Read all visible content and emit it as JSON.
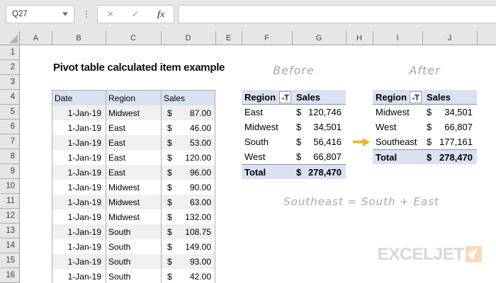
{
  "formula_bar": {
    "name_box_value": "Q27",
    "cancel_glyph": "✕",
    "enter_glyph": "✓",
    "fx_glyph": "fx",
    "formula_value": ""
  },
  "grid": {
    "column_letters": [
      "A",
      "B",
      "C",
      "D",
      "E",
      "F",
      "G",
      "H",
      "I",
      "J"
    ],
    "row_numbers": [
      "1",
      "2",
      "3",
      "4",
      "5",
      "6",
      "7",
      "8",
      "9",
      "10",
      "11",
      "12",
      "13",
      "14",
      "15",
      "16"
    ]
  },
  "title": "Pivot table calculated item example",
  "data_table": {
    "headers": {
      "date": "Date",
      "region": "Region",
      "sales": "Sales"
    },
    "rows": [
      {
        "date": "1-Jan-19",
        "region": "Midwest",
        "currency": "$",
        "amount": "87.00"
      },
      {
        "date": "1-Jan-19",
        "region": "East",
        "currency": "$",
        "amount": "46.00"
      },
      {
        "date": "1-Jan-19",
        "region": "East",
        "currency": "$",
        "amount": "53.00"
      },
      {
        "date": "1-Jan-19",
        "region": "East",
        "currency": "$",
        "amount": "120.00"
      },
      {
        "date": "1-Jan-19",
        "region": "East",
        "currency": "$",
        "amount": "96.00"
      },
      {
        "date": "1-Jan-19",
        "region": "Midwest",
        "currency": "$",
        "amount": "90.00"
      },
      {
        "date": "1-Jan-19",
        "region": "Midwest",
        "currency": "$",
        "amount": "63.00"
      },
      {
        "date": "1-Jan-19",
        "region": "Midwest",
        "currency": "$",
        "amount": "132.00"
      },
      {
        "date": "1-Jan-19",
        "region": "South",
        "currency": "$",
        "amount": "108.75"
      },
      {
        "date": "1-Jan-19",
        "region": "South",
        "currency": "$",
        "amount": "149.00"
      },
      {
        "date": "1-Jan-19",
        "region": "South",
        "currency": "$",
        "amount": "93.00"
      },
      {
        "date": "1-Jan-19",
        "region": "South",
        "currency": "$",
        "amount": "42.00"
      }
    ]
  },
  "before_pivot": {
    "label": "Before",
    "headers": {
      "region": "Region",
      "sales": "Sales"
    },
    "rows": [
      {
        "region": "East",
        "currency": "$",
        "amount": "120,746"
      },
      {
        "region": "Midwest",
        "currency": "$",
        "amount": "34,501"
      },
      {
        "region": "South",
        "currency": "$",
        "amount": "56,416"
      },
      {
        "region": "West",
        "currency": "$",
        "amount": "66,807"
      }
    ],
    "total": {
      "label": "Total",
      "currency": "$",
      "amount": "278,470"
    }
  },
  "after_pivot": {
    "label": "After",
    "headers": {
      "region": "Region",
      "sales": "Sales"
    },
    "rows": [
      {
        "region": "Midwest",
        "currency": "$",
        "amount": "34,501"
      },
      {
        "region": "West",
        "currency": "$",
        "amount": "66,807"
      },
      {
        "region": "Southeast",
        "currency": "$",
        "amount": "177,161"
      }
    ],
    "total": {
      "label": "Total",
      "currency": "$",
      "amount": "278,470"
    }
  },
  "annotation": "Southeast = South + East",
  "logo": {
    "text": "EXCELJET"
  },
  "colors": {
    "table_header": "#d9e1f2",
    "band": "#f0f0f0",
    "pivot_border": "#8496b0",
    "arrow": "#f0b32c",
    "script_gray": "#a9a9a9",
    "logo_gray": "#d8d8d8",
    "logo_square": "#f9d9bd",
    "toolbar_bg": "#e7e7e7",
    "header_bg": "#e6e6e6"
  }
}
